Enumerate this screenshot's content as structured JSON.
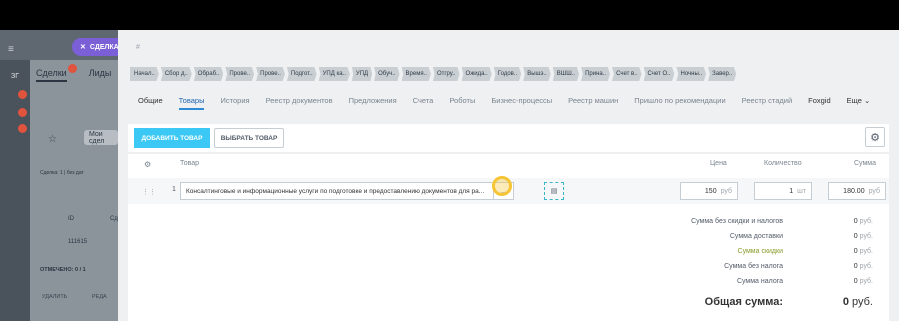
{
  "left": {
    "count": "ЗГ",
    "deal_chip": "СДЕЛКА",
    "tabs": [
      "Сделки",
      "Лиды"
    ],
    "my_deals": "Мои сдел",
    "filter_label": "Сделка: 1 | без дат",
    "id_header": "ID",
    "sd_header": "Сд",
    "row_id": "111615",
    "selected": "ОТМЕЧЕНО: 0 / 1",
    "delete": "УДАЛИТЬ",
    "edit": "РЕДА"
  },
  "breadcrumb": "#",
  "stages": [
    "Начал..",
    "Сбор д..",
    "Обраб..",
    "Прове..",
    "Прове..",
    "Подгот..",
    "УПД ка..",
    "УПД",
    "Обуч..",
    "Время..",
    "Отгру..",
    "Ожида..",
    "Годов..",
    "Вышэ..",
    "ВШШ..",
    "Прина..",
    "Счет в..",
    "Счет О..",
    "Ночны..",
    "Завер.."
  ],
  "tabs": [
    "Общие",
    "Товары",
    "История",
    "Реестр документов",
    "Предложения",
    "Счета",
    "Роботы",
    "Бизнес-процессы",
    "Реестр машин",
    "Пришло по рекомендации",
    "Реестр стадий",
    "Foxgid",
    "Еще"
  ],
  "toolbar": {
    "add_product": "ДОБАВИТЬ ТОВАР",
    "select_product": "ВЫБРАТЬ ТОВАР"
  },
  "table": {
    "headers": {
      "product": "Товар",
      "price": "Цена",
      "quantity": "Количество",
      "sum": "Сумма"
    },
    "rows": [
      {
        "num": "1",
        "name": "Консалтинговые и информационные   услуги по подготовке и предоставлению документов для ра...",
        "price": "150",
        "price_unit": "руб",
        "qty": "1",
        "qty_unit": "шт",
        "sum": "180.00",
        "sum_unit": "руб"
      }
    ]
  },
  "totals": [
    {
      "label": "Сумма без скидки и налогов",
      "value": "0",
      "unit": "руб."
    },
    {
      "label": "Сумма доставки",
      "value": "0",
      "unit": "руб."
    },
    {
      "label": "Сумма скидки",
      "value": "0",
      "unit": "руб."
    },
    {
      "label": "Сумма без налога",
      "value": "0",
      "unit": "руб."
    },
    {
      "label": "Сумма налога",
      "value": "0",
      "unit": "руб."
    }
  ],
  "grand_total": {
    "label": "Общая сумма:",
    "value": "0",
    "unit": "руб."
  },
  "colors": {
    "accent": "#3bc8f5",
    "tab_active": "#2067b0",
    "discount_label": "#8a9a2a"
  }
}
